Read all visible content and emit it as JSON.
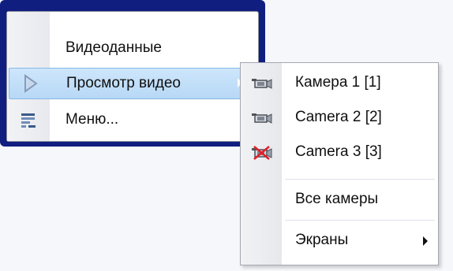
{
  "main_menu": {
    "items": [
      {
        "label": "Видеоданные",
        "icon": "none"
      },
      {
        "label": "Просмотр видео",
        "icon": "play-arrow-icon",
        "has_submenu": true,
        "highlighted": true
      },
      {
        "label": "Меню...",
        "icon": "menu-list-icon"
      }
    ]
  },
  "submenu": {
    "items": [
      {
        "label": "Камера 1 [1]",
        "icon": "camera-icon"
      },
      {
        "label": "Camera 2 [2]",
        "icon": "camera-icon"
      },
      {
        "label": "Camera 3 [3]",
        "icon": "camera-disabled-icon"
      },
      {
        "label": "Все камеры",
        "icon": "none"
      },
      {
        "label": "Экраны",
        "icon": "none",
        "has_submenu": true
      }
    ]
  },
  "colors": {
    "window_frame": "#101e80",
    "highlight": "#c4e0f9",
    "disabled_mark": "#e0202a"
  }
}
